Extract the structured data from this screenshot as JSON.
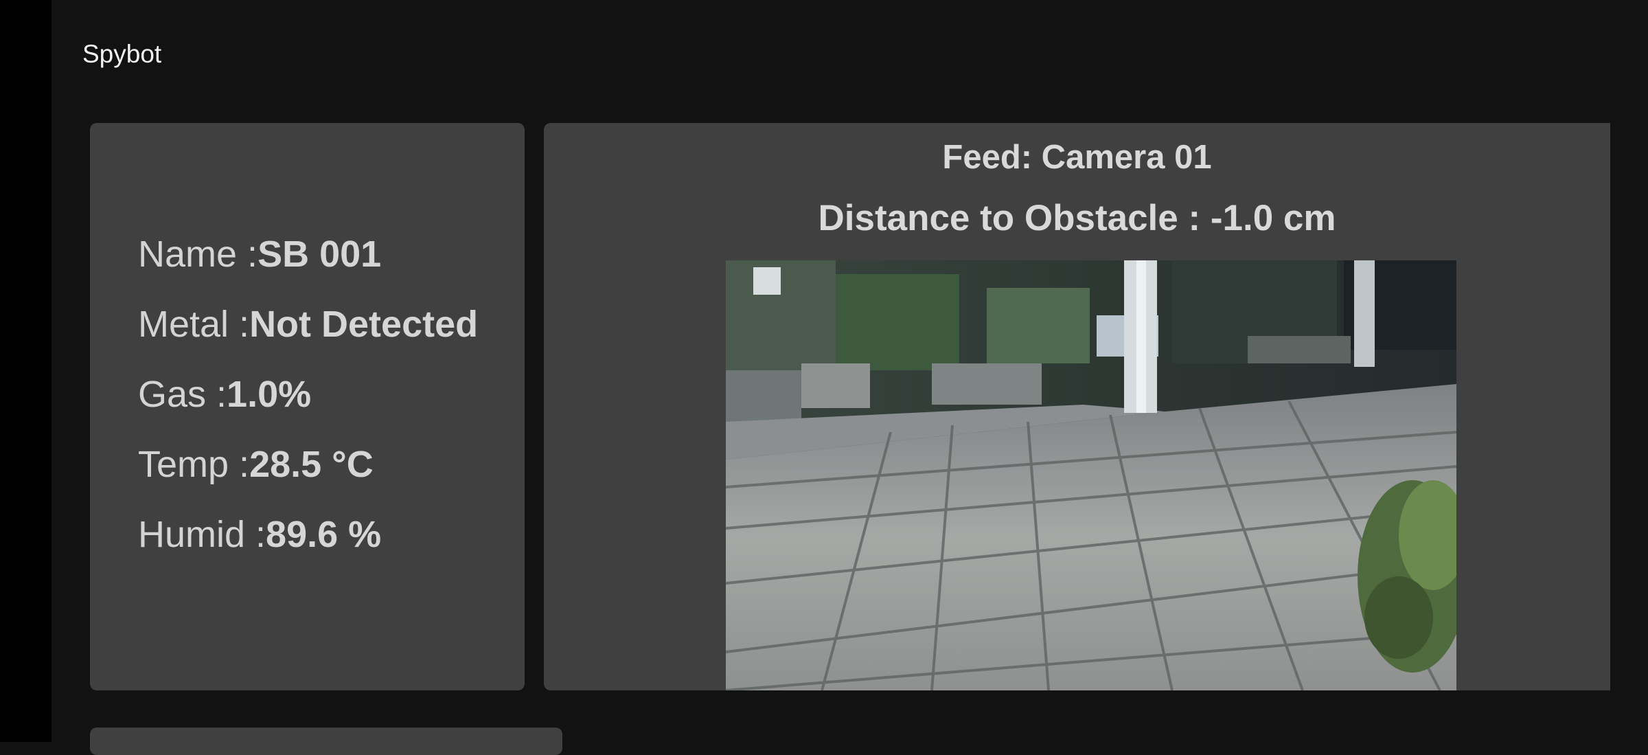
{
  "app": {
    "title": "Spybot"
  },
  "sensors": [
    {
      "label": "Name :",
      "value": "SB 001"
    },
    {
      "label": "Metal :",
      "value": "Not Detected"
    },
    {
      "label": "Gas :",
      "value": "1.0%"
    },
    {
      "label": "Temp :",
      "value": "28.5 °C"
    },
    {
      "label": "Humid :",
      "value": "89.6 %"
    }
  ],
  "feed": {
    "title": "Feed: Camera 01",
    "distance_label": "Distance to Obstacle : ",
    "distance_value": "-1.0 cm"
  },
  "colors": {
    "background": "#121212",
    "card": "#404040",
    "text": "#d4d4d4"
  }
}
